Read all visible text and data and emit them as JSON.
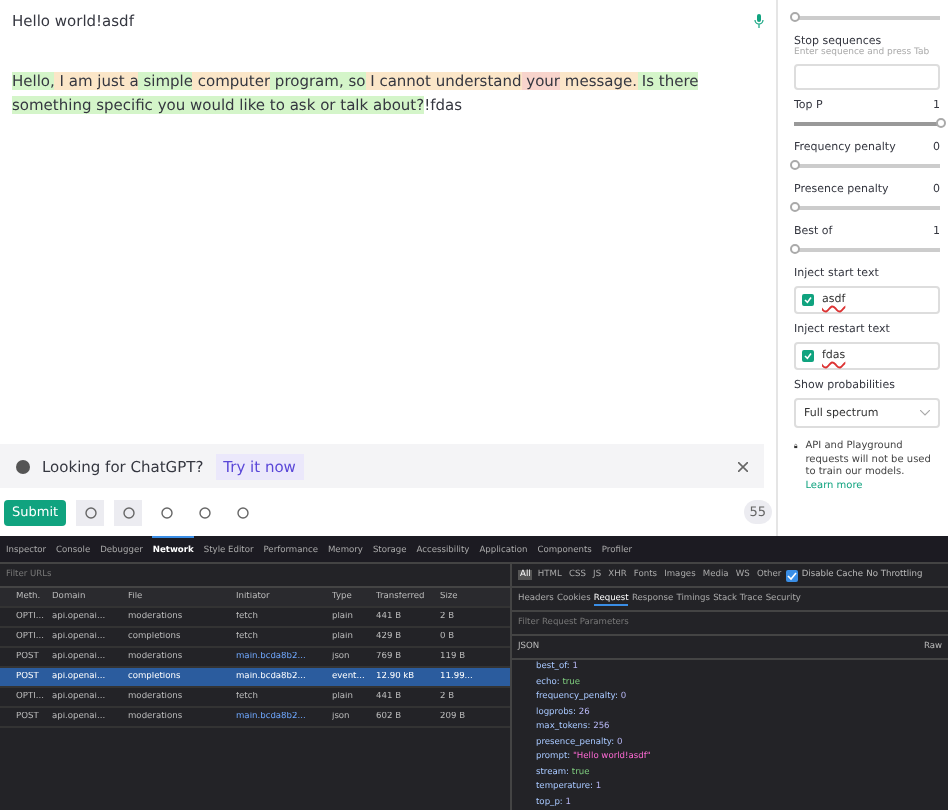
{
  "prompt": {
    "text": "Hello world!asdf"
  },
  "completion": {
    "segments": [
      {
        "text": "Hello,",
        "color": "#d4f5c9"
      },
      {
        "text": " I am just a",
        "color": "#fbe6c8"
      },
      {
        "text": " simple",
        "color": "#d4f5c9"
      },
      {
        "text": " computer",
        "color": "#fbe6c8"
      },
      {
        "text": " program, so",
        "color": "#d4f5c9"
      },
      {
        "text": " I cannot understand",
        "color": "#fbe6c8"
      },
      {
        "text": " your",
        "color": "#f8d4cc"
      },
      {
        "text": " message.",
        "color": "#fbe6c8"
      },
      {
        "text": " Is there something specific you would like to ask or talk about?",
        "color": "#d4f5c9"
      }
    ],
    "suffix": "!fdas"
  },
  "banner": {
    "text": "Looking for ChatGPT?",
    "link": "Try it now"
  },
  "toolbar": {
    "submit": "Submit",
    "token_count": "55"
  },
  "sidebar": {
    "top_slider": {
      "level": 0
    },
    "stop_sequences": {
      "label": "Stop sequences",
      "hint": "Enter sequence and press Tab"
    },
    "sliders": [
      {
        "label": "Top P",
        "reading": "1",
        "level": 1
      },
      {
        "label": "Frequency penalty",
        "reading": "0",
        "level": 0
      },
      {
        "label": "Presence penalty",
        "reading": "0",
        "level": 0
      },
      {
        "label": "Best of",
        "reading": "1",
        "level": 0
      }
    ],
    "injects": [
      {
        "label": "Inject start text",
        "value": "asdf",
        "checked": true
      },
      {
        "label": "Inject restart text",
        "value": "fdas",
        "checked": true
      }
    ],
    "probabilities": {
      "label": "Show probabilities",
      "value": "Full spectrum"
    },
    "notice": {
      "text": "API and Playground requests will not be used to train our models.",
      "link": "Learn more"
    }
  },
  "devtools": {
    "tabs": [
      {
        "label": "Inspector",
        "selected": false
      },
      {
        "label": "Console",
        "selected": false
      },
      {
        "label": "Debugger",
        "selected": false
      },
      {
        "label": "Network",
        "selected": true
      },
      {
        "label": "Style Editor",
        "selected": false
      },
      {
        "label": "Performance",
        "selected": false
      },
      {
        "label": "Memory",
        "selected": false
      },
      {
        "label": "Storage",
        "selected": false
      },
      {
        "label": "Accessibility",
        "selected": false
      },
      {
        "label": "Application",
        "selected": false
      },
      {
        "label": "Components",
        "selected": false
      },
      {
        "label": "Profiler",
        "selected": false
      }
    ],
    "filter_placeholder": "Filter URLs",
    "columns": [
      "Meth.",
      "Domain",
      "File",
      "Initiator",
      "Type",
      "Transferred",
      "Size"
    ],
    "rows": [
      {
        "cells": [
          "OPTI...",
          "api.openai...",
          "moderations",
          "fetch",
          "plain",
          "441 B",
          "2 B"
        ],
        "selected": false
      },
      {
        "cells": [
          "OPTI...",
          "api.openai...",
          "completions",
          "fetch",
          "plain",
          "429 B",
          "0 B"
        ],
        "selected": false
      },
      {
        "cells": [
          "POST",
          "api.openai...",
          "moderations",
          "main.bcda8b2...",
          "json",
          "769 B",
          "119 B"
        ],
        "selected": false
      },
      {
        "cells": [
          "POST",
          "api.openai...",
          "completions",
          "main.bcda8b2...",
          "event...",
          "12.90 kB",
          "11.99..."
        ],
        "selected": true
      },
      {
        "cells": [
          "OPTI...",
          "api.openai...",
          "moderations",
          "fetch",
          "plain",
          "441 B",
          "2 B"
        ],
        "selected": false
      },
      {
        "cells": [
          "POST",
          "api.openai...",
          "moderations",
          "main.bcda8b2...",
          "json",
          "602 B",
          "209 B"
        ],
        "selected": false
      }
    ],
    "type_filters": [
      {
        "label": "All",
        "selected": true
      },
      {
        "label": "HTML",
        "selected": false
      },
      {
        "label": "CSS",
        "selected": false
      },
      {
        "label": "JS",
        "selected": false
      },
      {
        "label": "XHR",
        "selected": false
      },
      {
        "label": "Fonts",
        "selected": false
      },
      {
        "label": "Images",
        "selected": false
      },
      {
        "label": "Media",
        "selected": false
      },
      {
        "label": "WS",
        "selected": false
      },
      {
        "label": "Other",
        "selected": false
      }
    ],
    "disable_cache": {
      "label": "Disable Cache",
      "checked": true
    },
    "throttling": "No Throttling",
    "detail_tabs": [
      {
        "label": "Headers",
        "selected": false
      },
      {
        "label": "Cookies",
        "selected": false
      },
      {
        "label": "Request",
        "selected": true
      },
      {
        "label": "Response",
        "selected": false
      },
      {
        "label": "Timings",
        "selected": false
      },
      {
        "label": "Stack Trace",
        "selected": false
      },
      {
        "label": "Security",
        "selected": false
      }
    ],
    "params_placeholder": "Filter Request Parameters",
    "json_label": "JSON",
    "raw_label": "Raw",
    "params": [
      {
        "key": "best_of:",
        "value": "1",
        "kind": "number"
      },
      {
        "key": "echo:",
        "value": "true",
        "kind": "bool"
      },
      {
        "key": "frequency_penalty:",
        "value": "0",
        "kind": "number"
      },
      {
        "key": "logprobs:",
        "value": "26",
        "kind": "number"
      },
      {
        "key": "max_tokens:",
        "value": "256",
        "kind": "number"
      },
      {
        "key": "presence_penalty:",
        "value": "0",
        "kind": "number"
      },
      {
        "key": "prompt:",
        "value": "\"Hello world!asdf\"",
        "kind": "string"
      },
      {
        "key": "stream:",
        "value": "true",
        "kind": "bool"
      },
      {
        "key": "temperature:",
        "value": "1",
        "kind": "number"
      },
      {
        "key": "top_p:",
        "value": "1",
        "kind": "number"
      }
    ]
  }
}
